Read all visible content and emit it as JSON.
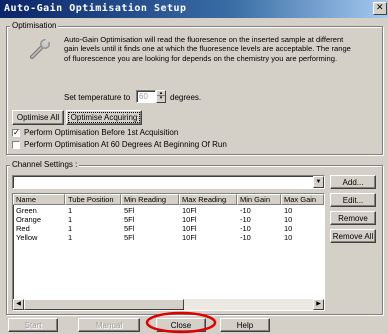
{
  "window": {
    "title": "Auto-Gain Optimisation Setup",
    "close_glyph": "✕"
  },
  "optimisation": {
    "legend": "Optimisation",
    "description": "Auto-Gain Optimisation will read the fluoresence on the inserted sample at different gain levels until it finds one at which the fluoresence levels are acceptable. The range of fluorescence you are looking for depends on the chemistry you are performing.",
    "temp_prefix": "Set temperature to",
    "temp_value": "60",
    "temp_suffix": "degrees.",
    "optimise_all": "Optimise All",
    "optimise_acquiring": "Optimise Acquiring",
    "check1_label": "Perform Optimisation Before 1st Acquisition",
    "check1_checked": true,
    "check2_label": "Perform Optimisation At 60 Degrees At Beginning Of Run",
    "check2_checked": false
  },
  "channels": {
    "legend": "Channel Settings :",
    "add": "Add...",
    "edit": "Edit...",
    "remove": "Remove",
    "remove_all": "Remove All",
    "columns": [
      "Name",
      "Tube Position",
      "Min Reading",
      "Max Reading",
      "Min Gain",
      "Max Gain"
    ],
    "rows": [
      [
        "Green",
        "1",
        "5Fl",
        "10Fl",
        "-10",
        "10"
      ],
      [
        "Orange",
        "1",
        "5Fl",
        "10Fl",
        "-10",
        "10"
      ],
      [
        "Red",
        "1",
        "5Fl",
        "10Fl",
        "-10",
        "10"
      ],
      [
        "Yellow",
        "1",
        "5Fl",
        "10Fl",
        "-10",
        "10"
      ]
    ]
  },
  "footer": {
    "start": "Start",
    "manual": "Manual",
    "close": "Close",
    "help": "Help"
  },
  "colors": {
    "annotation": "#e00000"
  }
}
